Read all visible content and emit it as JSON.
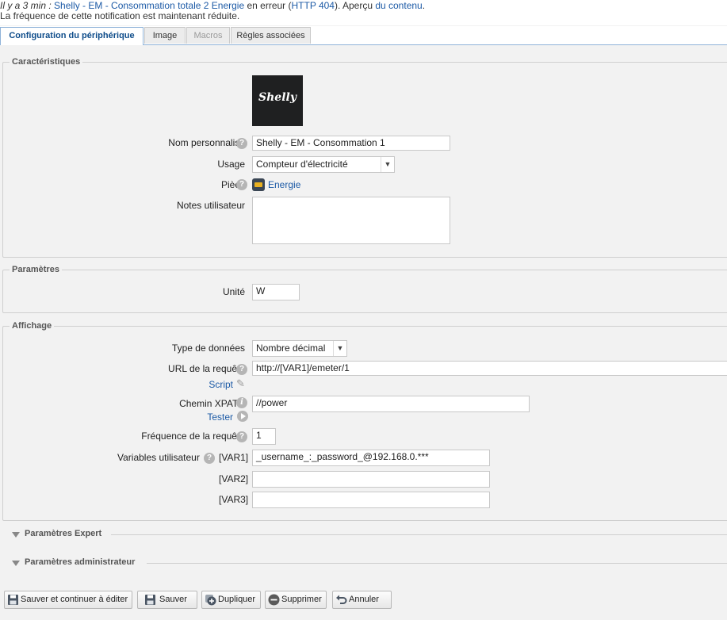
{
  "notification": {
    "line1_prefix": "Il y a 3 min : ",
    "device_link": "Shelly - EM - Consommation totale 2 Energie",
    "line1_mid": " en erreur (",
    "error_link": "HTTP 404",
    "line1_mid2": "). Aperçu ",
    "content_link": "du contenu",
    "line1_end": ".",
    "line2": "La fréquence de cette notification est maintenant réduite."
  },
  "tabs": [
    {
      "label": "Configuration du périphérique",
      "state": "active"
    },
    {
      "label": "Image",
      "state": "normal"
    },
    {
      "label": "Macros",
      "state": "disabled"
    },
    {
      "label": "Règles associées",
      "state": "normal"
    }
  ],
  "characteristics": {
    "legend": "Caractéristiques",
    "logo_text": "Shelly",
    "name_label": "Nom personnalisé",
    "name_value": "Shelly - EM - Consommation 1",
    "usage_label": "Usage",
    "usage_value": "Compteur d'électricité",
    "room_label": "Pièce",
    "room_value": "Energie",
    "notes_label": "Notes utilisateur",
    "notes_value": ""
  },
  "parameters": {
    "legend": "Paramètres",
    "unit_label": "Unité",
    "unit_value": "W"
  },
  "display": {
    "legend": "Affichage",
    "data_type_label": "Type de données",
    "data_type_value": "Nombre décimal",
    "url_label": "URL de la requête",
    "url_value": "http://[VAR1]/emeter/1",
    "script_link": "Script",
    "xpath_label": "Chemin XPATH",
    "xpath_value": "//power",
    "test_link": "Tester",
    "frequency_label": "Fréquence de la requête",
    "frequency_value": "1",
    "vars_label": "Variables utilisateur",
    "var1_label": "[VAR1]",
    "var1_value": "_username_:_password_@192.168.0.***",
    "var2_label": "[VAR2]",
    "var2_value": "",
    "var3_label": "[VAR3]",
    "var3_value": ""
  },
  "sections": {
    "expert": "Paramètres Expert",
    "admin": "Paramètres administrateur"
  },
  "buttons": {
    "save_continue": "Sauver et continuer à éditer",
    "save": "Sauver",
    "duplicate": "Dupliquer",
    "delete": "Supprimer",
    "cancel": "Annuler"
  },
  "colors": {
    "link": "#1c5aa6",
    "active_tab": "#0e4c8a",
    "help_icon": "#b5b5b5",
    "delete_icon": "#666666"
  }
}
